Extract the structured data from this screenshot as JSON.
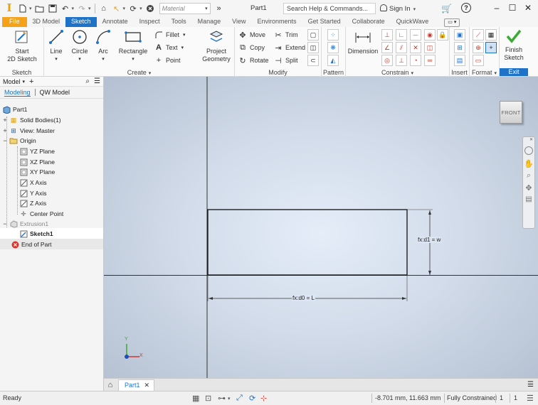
{
  "app": {
    "logo_letter": "I",
    "material_placeholder": "Material",
    "doc_title": "Part1",
    "search_placeholder": "Search Help & Commands...",
    "signin": "Sign In"
  },
  "tabs": [
    {
      "label": "File"
    },
    {
      "label": "3D Model"
    },
    {
      "label": "Sketch"
    },
    {
      "label": "Annotate"
    },
    {
      "label": "Inspect"
    },
    {
      "label": "Tools"
    },
    {
      "label": "Manage"
    },
    {
      "label": "View"
    },
    {
      "label": "Environments"
    },
    {
      "label": "Get Started"
    },
    {
      "label": "Collaborate"
    },
    {
      "label": "QuickWave"
    }
  ],
  "ribbon": {
    "sketch_panel": {
      "label": "Sketch",
      "start_line1": "Start",
      "start_line2": "2D Sketch"
    },
    "create_panel": {
      "label": "Create",
      "line": "Line",
      "circle": "Circle",
      "arc": "Arc",
      "rectangle": "Rectangle",
      "fillet": "Fillet",
      "text": "Text",
      "point": "Point",
      "project_line1": "Project",
      "project_line2": "Geometry"
    },
    "modify_panel": {
      "label": "Modify",
      "move": "Move",
      "trim": "Trim",
      "copy": "Copy",
      "extend": "Extend",
      "rotate": "Rotate",
      "split": "Split"
    },
    "pattern_panel": {
      "label": "Pattern"
    },
    "constrain_panel": {
      "label": "Constrain",
      "dimension": "Dimension"
    },
    "insert_panel": {
      "label": "Insert"
    },
    "format_panel": {
      "label": "Format"
    },
    "exit_panel": {
      "finish_line1": "Finish",
      "finish_line2": "Sketch",
      "exit": "Exit"
    }
  },
  "browser": {
    "title": "Model",
    "tabs": [
      "Modeling",
      "QW Model"
    ],
    "tree": [
      {
        "label": "Part1"
      },
      {
        "label": "Solid Bodies(1)"
      },
      {
        "label": "View: Master"
      },
      {
        "label": "Origin"
      },
      {
        "label": "YZ Plane"
      },
      {
        "label": "XZ Plane"
      },
      {
        "label": "XY Plane"
      },
      {
        "label": "X Axis"
      },
      {
        "label": "Y Axis"
      },
      {
        "label": "Z Axis"
      },
      {
        "label": "Center Point"
      },
      {
        "label": "Extrusion1"
      },
      {
        "label": "Sketch1"
      },
      {
        "label": "End of Part"
      }
    ]
  },
  "canvas": {
    "viewcube_label": "FRONT",
    "dim_height": "fx:d1 = w",
    "dim_width": "fx:d0 = L",
    "triad_y": "Y",
    "triad_x": "X"
  },
  "doc_tabs": [
    {
      "label": "Part1"
    }
  ],
  "status": {
    "left": "Ready",
    "coords": "-8.701 mm, 11.663 mm",
    "constraint": "Fully Constrained",
    "count1": "1",
    "count2": "1"
  },
  "colors": {
    "accent": "#1e73c8",
    "file_tab": "#f5a21b",
    "finish_check": "#3aaa35"
  }
}
